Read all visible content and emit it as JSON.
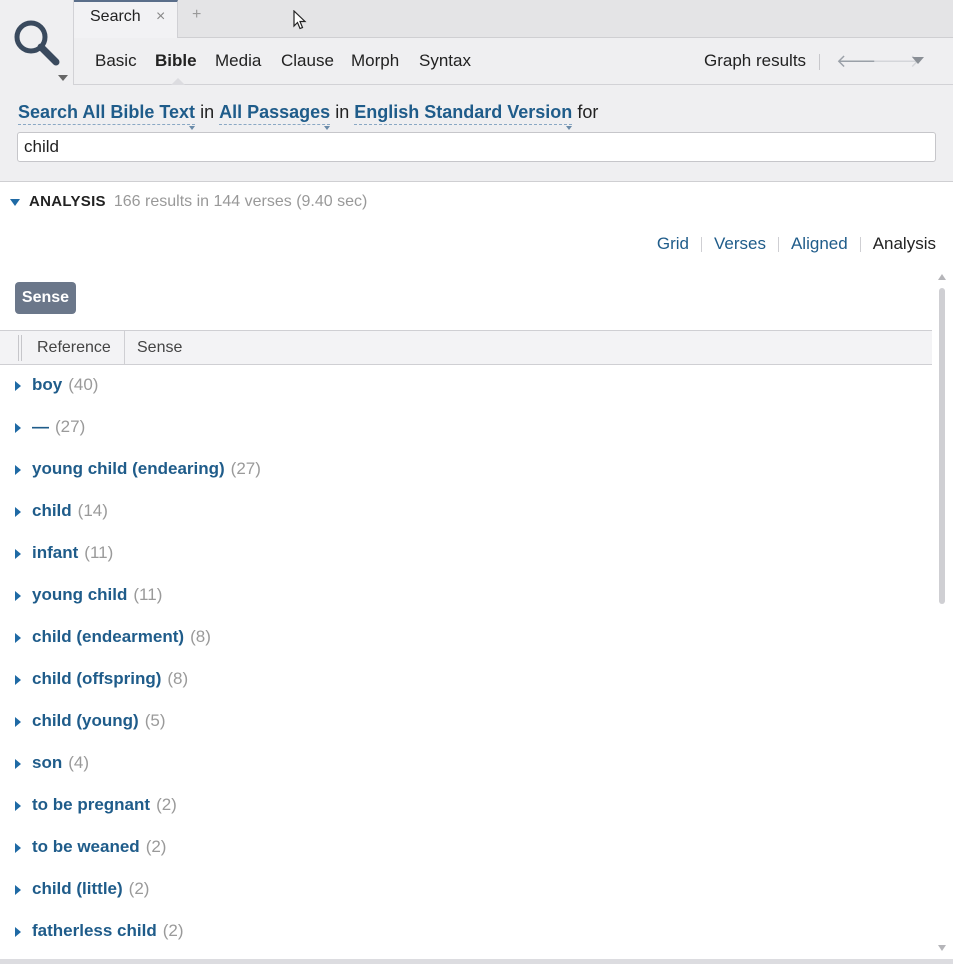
{
  "tab": {
    "label": "Search",
    "close_glyph": "×",
    "add_glyph": "+"
  },
  "toolbar": {
    "modes": [
      "Basic",
      "Bible",
      "Media",
      "Clause",
      "Morph",
      "Syntax"
    ],
    "active_mode": "Bible",
    "graph_results": "Graph results",
    "back_glyph": "🡐",
    "forward_glyph": "🡒"
  },
  "query": {
    "search_what": "Search All Bible Text",
    "in1": "in",
    "passages": "All Passages",
    "in2": "in",
    "version": "English Standard Version",
    "for_word": "for",
    "input_value": "child"
  },
  "analysis": {
    "label": "ANALYSIS",
    "stats": "166 results in 144 verses (9.40 sec)"
  },
  "views": {
    "grid": "Grid",
    "verses": "Verses",
    "aligned": "Aligned",
    "analysis": "Analysis"
  },
  "sense_button": "Sense",
  "columns": {
    "reference": "Reference",
    "sense": "Sense"
  },
  "rows": [
    {
      "term": "boy",
      "count": "(40)"
    },
    {
      "term": "—",
      "count": "(27)"
    },
    {
      "term": "young child (endearing)",
      "count": "(27)"
    },
    {
      "term": "child",
      "count": "(14)"
    },
    {
      "term": "infant",
      "count": "(11)"
    },
    {
      "term": "young child",
      "count": "(11)"
    },
    {
      "term": "child (endearment)",
      "count": "(8)"
    },
    {
      "term": "child (offspring)",
      "count": "(8)"
    },
    {
      "term": "child (young)",
      "count": "(5)"
    },
    {
      "term": "son",
      "count": "(4)"
    },
    {
      "term": "to be pregnant",
      "count": "(2)"
    },
    {
      "term": "to be weaned",
      "count": "(2)"
    },
    {
      "term": "child (little)",
      "count": "(2)"
    },
    {
      "term": "fatherless child",
      "count": "(2)"
    }
  ],
  "colors": {
    "link": "#1f5c8a",
    "accent": "#1f6aa5",
    "count": "#9a9a9a",
    "button": "#6b778a"
  },
  "icons": {
    "logo": "search-icon",
    "row_toggle": "triangle-right-icon",
    "section_toggle": "triangle-down-icon"
  }
}
